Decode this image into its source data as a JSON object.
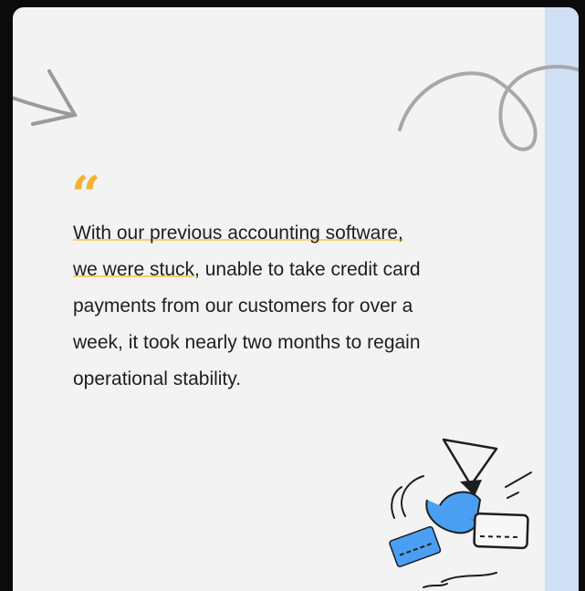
{
  "quote": {
    "mark": "“",
    "lines": [
      {
        "highlight": "With our previous accounting software,",
        "rest": ""
      },
      {
        "highlight": "we were stuck",
        "rest": ", unable to take credit card"
      },
      {
        "highlight": "",
        "rest": "payments from our customers for over a"
      },
      {
        "highlight": "",
        "rest": "week, it took nearly two months to regain"
      },
      {
        "highlight": "",
        "rest": "operational stability."
      }
    ]
  },
  "colors": {
    "quote_mark": "#f3b234",
    "highlight": "#f6cf6a",
    "side_panel": "#cfe0f5",
    "card_blue": "#4a9ff2"
  },
  "icons": [
    "arrow-right-doodle-icon",
    "loop-doodle-icon",
    "hourglass-icon",
    "credit-card-icon"
  ]
}
